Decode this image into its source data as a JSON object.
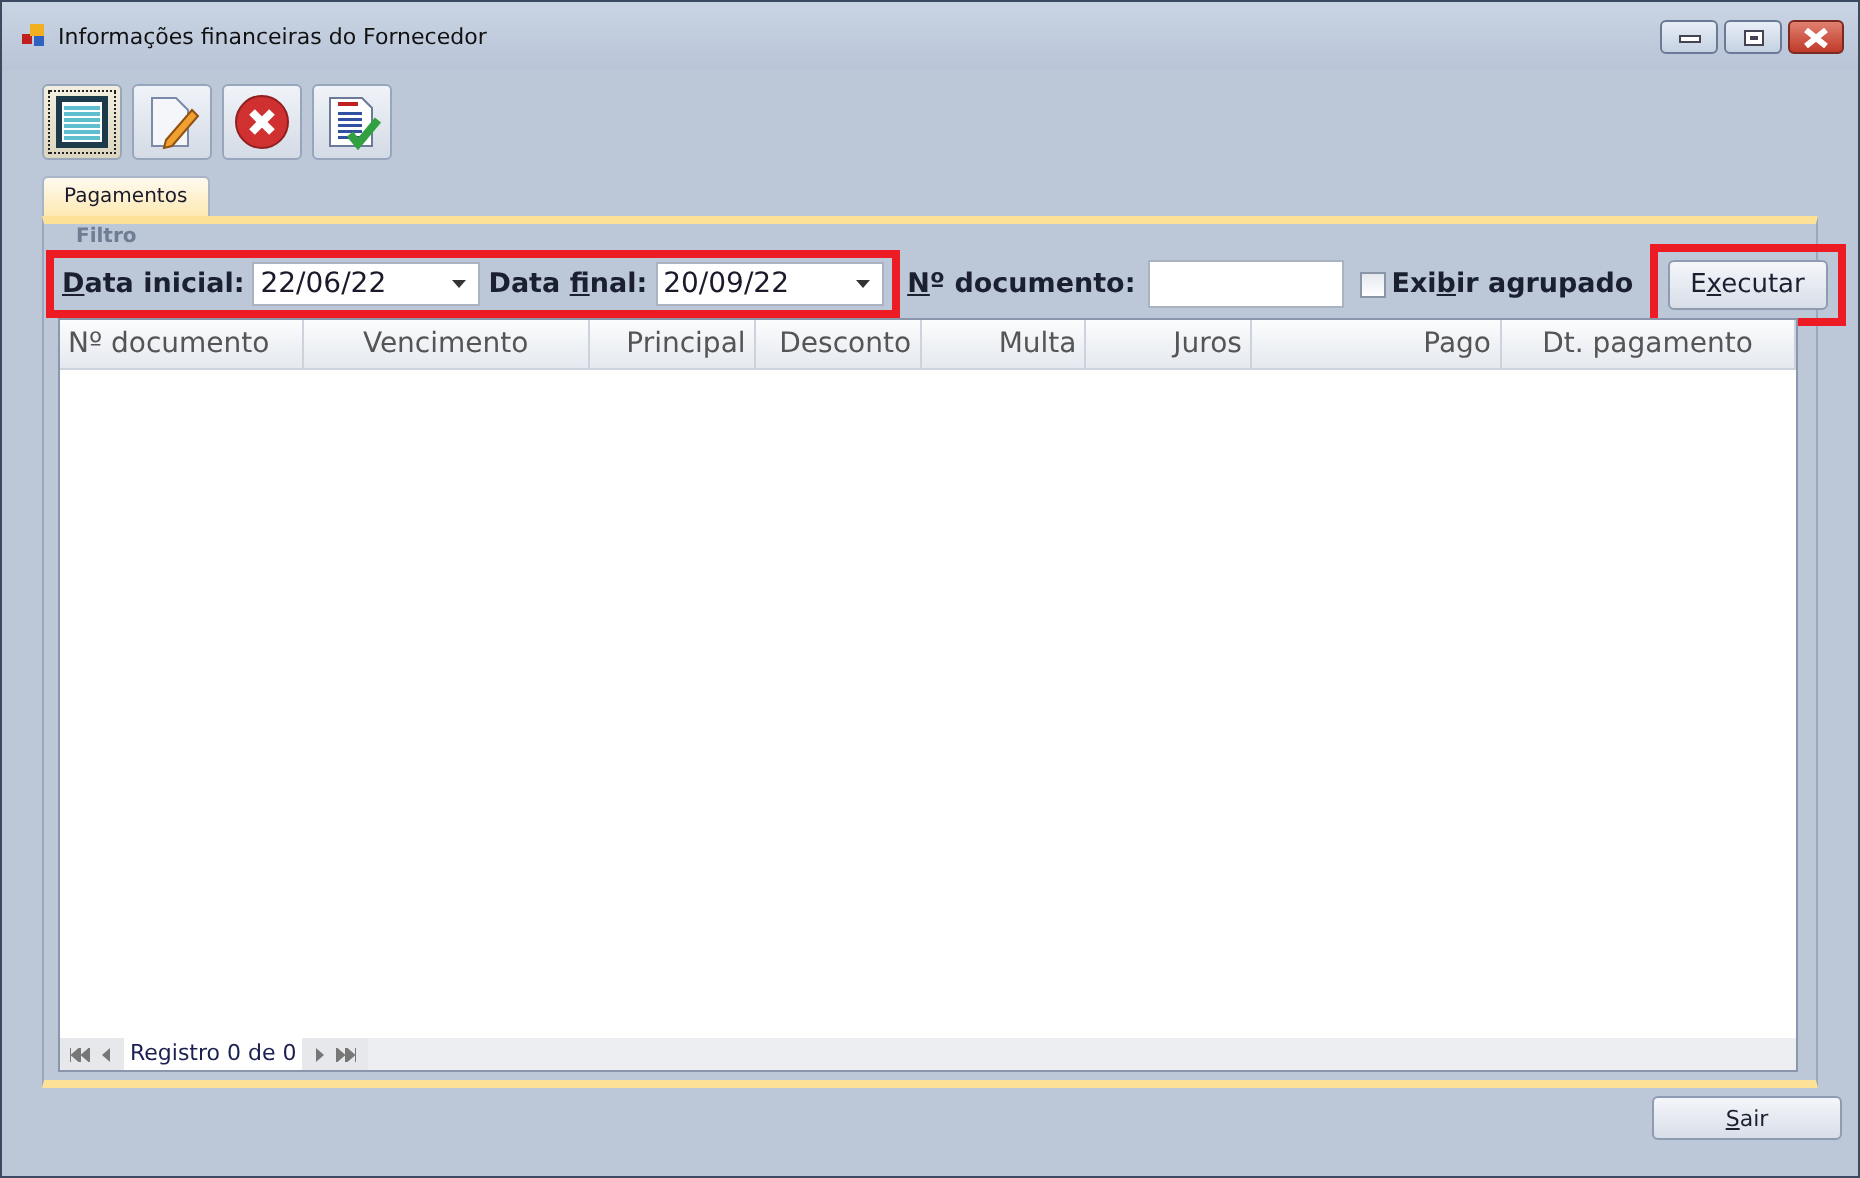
{
  "window": {
    "title": "Informações financeiras do Fornecedor"
  },
  "toolbar": [
    {
      "kind": "list",
      "selected": true
    },
    {
      "kind": "edit",
      "selected": false
    },
    {
      "kind": "delete",
      "selected": false
    },
    {
      "kind": "report",
      "selected": false
    }
  ],
  "tabs": [
    {
      "label": "Pagamentos",
      "selected": true
    }
  ],
  "filter": {
    "title": "Filtro",
    "date_group": {
      "highlighted": true,
      "fields": [
        {
          "label": [
            {
              "text": "D",
              "underline": true
            },
            {
              "text": "ata inicial:",
              "underline": false
            }
          ],
          "value": "22/06/22"
        },
        {
          "label": [
            {
              "text": "Data ",
              "underline": false
            },
            {
              "text": "f",
              "underline": true
            },
            {
              "text": "inal:",
              "underline": false
            }
          ],
          "value": "20/09/22"
        }
      ]
    },
    "document": {
      "label": [
        {
          "text": "N",
          "underline": true
        },
        {
          "text": "º documento:",
          "underline": false
        }
      ]
    },
    "grouped": {
      "label": [
        {
          "text": "Exi",
          "underline": false
        },
        {
          "text": "b",
          "underline": true
        },
        {
          "text": "ir agrupado",
          "underline": false
        }
      ],
      "checked": false
    },
    "execute_button": {
      "label": [
        {
          "text": "E",
          "underline": false
        },
        {
          "text": "x",
          "underline": true
        },
        {
          "text": "ecutar",
          "underline": false
        }
      ],
      "highlighted": true
    }
  },
  "table": {
    "columns": [
      "Nº documento",
      "Vencimento",
      "Principal",
      "Desconto",
      "Multa",
      "Juros",
      "Pago",
      "Dt. pagamento"
    ]
  },
  "navigator": {
    "text": "Registro 0 de 0"
  },
  "buttons": [
    {
      "label": [
        {
          "text": "S",
          "underline": true
        },
        {
          "text": "air",
          "underline": false
        }
      ]
    }
  ]
}
